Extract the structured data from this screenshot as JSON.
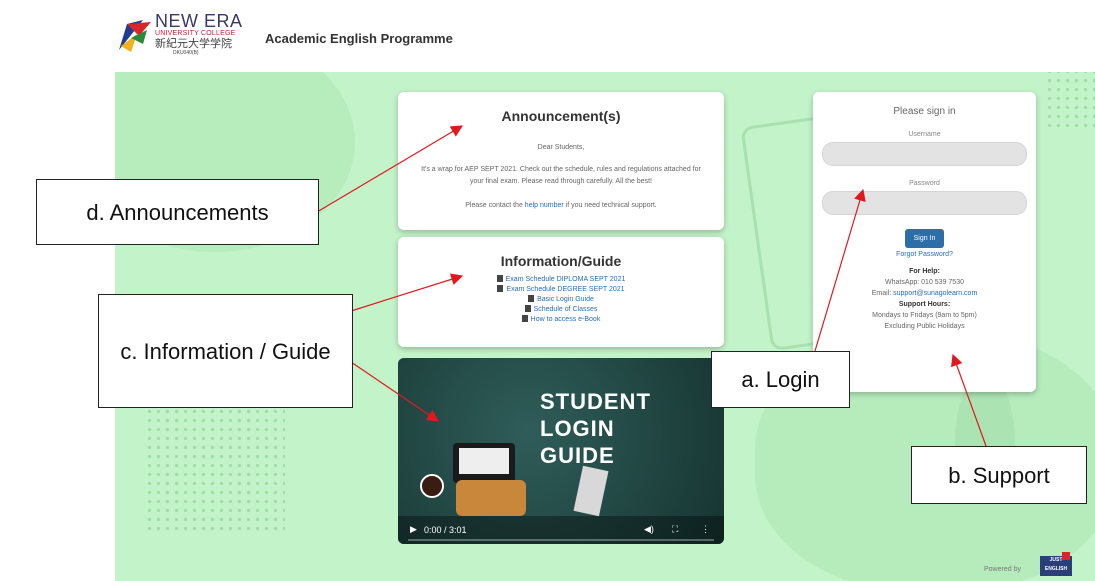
{
  "header": {
    "logo": {
      "main": "NEW ERA",
      "sub": "UNIVERSITY COLLEGE",
      "chinese": "新紀元大学学院",
      "code": "DKU040(B)"
    },
    "title": "Academic English Programme"
  },
  "announcement": {
    "title": "Announcement(s)",
    "greeting": "Dear Students,",
    "body": "It's a wrap for AEP SEPT 2021. Check out the schedule, rules and regulations attached for your final exam. Please read through carefully. All the best!",
    "contact_prefix": "Please contact the",
    "contact_link": "help number",
    "contact_suffix": "if you need technical support."
  },
  "info": {
    "title": "Information/Guide",
    "items": [
      "Exam Schedule DIPLOMA SEPT 2021",
      "Exam Schedule DEGREE SEPT 2021",
      "Basic Login Guide",
      "Schedule of Classes",
      "How to access e-Book"
    ]
  },
  "video": {
    "title_lines": [
      "STUDENT",
      "LOGIN",
      "GUIDE"
    ],
    "time": "0:00 / 3:01",
    "progress": 0
  },
  "login": {
    "title": "Please sign in",
    "username_label": "Username",
    "username_value": "",
    "password_label": "Password",
    "password_value": "",
    "signin_button": "Sign In",
    "forgot": "Forgot Password?",
    "help_title": "For Help:",
    "whatsapp": "WhatsApp: 010 539 7530",
    "email_prefix": "Email:",
    "email": "support@sunagolearn.com",
    "hours_title": "Support Hours:",
    "hours": "Mondays to Fridays (9am to 5pm)",
    "exclusion": "Excluding Public Holidays"
  },
  "footer": {
    "powered_by": "Powered by",
    "badge_top": "JUST",
    "badge_bottom": "ENGLISH"
  },
  "callouts": {
    "announcements": "d. Announcements",
    "information": "c. Information / Guide",
    "login": "a. Login",
    "support": "b. Support"
  },
  "colors": {
    "background_green": "#c3f3c9",
    "link_blue": "#2a6db3",
    "button_blue": "#2b6ea8",
    "arrow_red": "#e0191f"
  },
  "icons": {
    "document": "document-icon",
    "play": "play-icon",
    "volume": "volume-icon",
    "fullscreen": "fullscreen-icon",
    "more": "more-icon"
  }
}
